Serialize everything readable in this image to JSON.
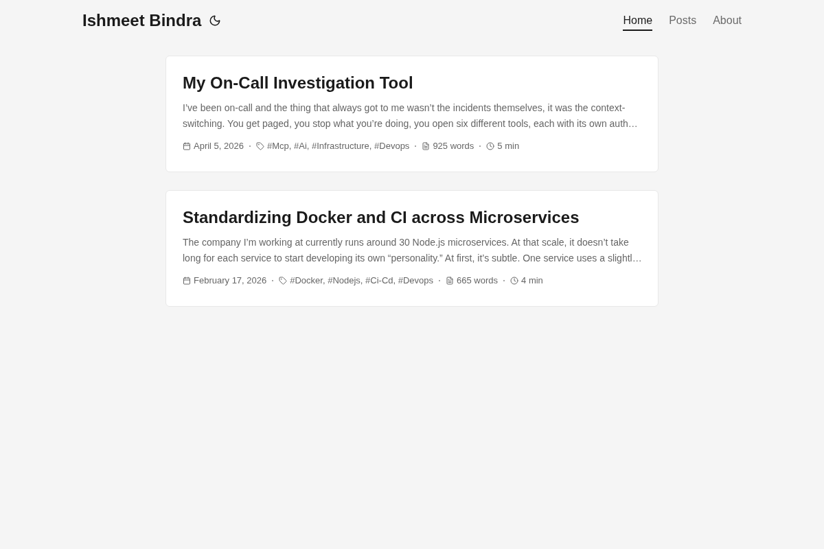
{
  "header": {
    "site_title": "Ishmeet Bindra",
    "nav": [
      {
        "label": "Home",
        "selected": true
      },
      {
        "label": "Posts",
        "selected": false
      },
      {
        "label": "About",
        "selected": false
      }
    ]
  },
  "posts": [
    {
      "title": "My On-Call Investigation Tool",
      "excerpt": "I’ve been on-call and the thing that always got to me wasn’t the incidents themselves, it was the context-switching. You get paged, you stop what you’re doing, you open six different tools, each with its own auth…",
      "meta": [
        {
          "kind": "date",
          "text": "April 5, 2026"
        },
        {
          "kind": "tags",
          "text": "#Mcp, #Ai, #Infrastructure, #Devops"
        },
        {
          "kind": "words",
          "text": "925 words"
        },
        {
          "kind": "time",
          "text": "5 min"
        }
      ]
    },
    {
      "title": "Standardizing Docker and CI across Microservices",
      "excerpt": "The company I’m working at currently runs around 30 Node.js microservices. At that scale, it doesn’t take long for each service to start developing its own “personality.” At first, it’s subtle. One service uses a slightl…",
      "meta": [
        {
          "kind": "date",
          "text": "February 17, 2026"
        },
        {
          "kind": "tags",
          "text": "#Docker, #Nodejs, #Ci-Cd, #Devops"
        },
        {
          "kind": "words",
          "text": "665 words"
        },
        {
          "kind": "time",
          "text": "4 min"
        }
      ]
    }
  ]
}
